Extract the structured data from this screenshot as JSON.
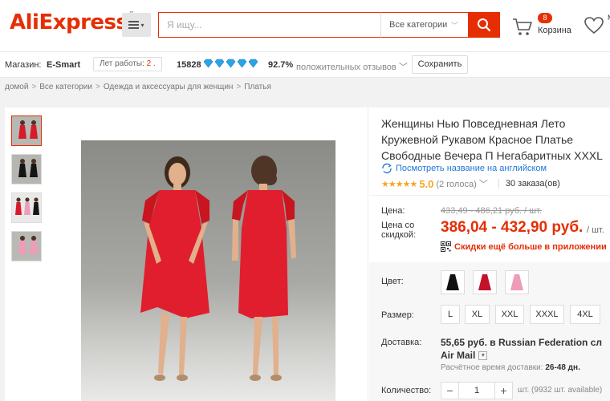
{
  "header": {
    "logo_text": "AliExpress",
    "search_placeholder": "Я ищу...",
    "category_select": "Все категории",
    "cart_count": "8",
    "cart_label": "Корзина",
    "wishlist_label": "М ж"
  },
  "store": {
    "label": "Магазин:",
    "name": "E-Smart",
    "years_label": "Лет работы:",
    "years_value": "2",
    "feedback_score": "15828",
    "positive_pct": "92.7%",
    "positive_label": "положительных отзывов",
    "save_label": "Сохранить"
  },
  "breadcrumbs": [
    "домой",
    "Все категории",
    "Одежда и аксессуары для женщин",
    "Платья"
  ],
  "product": {
    "title": "Женщины Нью Повседневная Лето Кружевной Рукавом Красное Платье Свободные Вечера П Негабаритных XXXL",
    "translate_link": "Посмотреть название на английском",
    "rating_value": "5.0",
    "votes": "(2 голоса)",
    "orders": "30 заказа(ов)",
    "price_label": "Цена:",
    "price_old": "433,49 - 486,21 руб. / шт.",
    "discount_label": "Цена со скидкой:",
    "price_new": "386,04 - 432,90 руб.",
    "per_unit": "/ шт.",
    "promo_text": "Скидки ещё больше в приложении"
  },
  "options": {
    "color_label": "Цвет:",
    "colors": [
      {
        "name": "black",
        "hex": "#111111"
      },
      {
        "name": "red",
        "hex": "#c4122b"
      },
      {
        "name": "pink",
        "hex": "#ee9cb7"
      }
    ],
    "size_label": "Размер:",
    "sizes": [
      "L",
      "XL",
      "XXL",
      "XXXL",
      "4XL"
    ],
    "shipping_label": "Доставка:",
    "shipping_price": "55,65 руб. в Russian Federation сл",
    "shipping_method": "Air Mail",
    "eta_label": "Расчётное время доставки:",
    "eta_value": "26-48 дн.",
    "qty_label": "Количество:",
    "qty_value": "1",
    "qty_minus": "−",
    "qty_plus": "+",
    "available": "шт. (9932 шт. available)"
  },
  "colors": {
    "brand": "#e62e04",
    "link": "#2176d9",
    "star": "#f5a623",
    "diamond": "#2aa4e6"
  }
}
